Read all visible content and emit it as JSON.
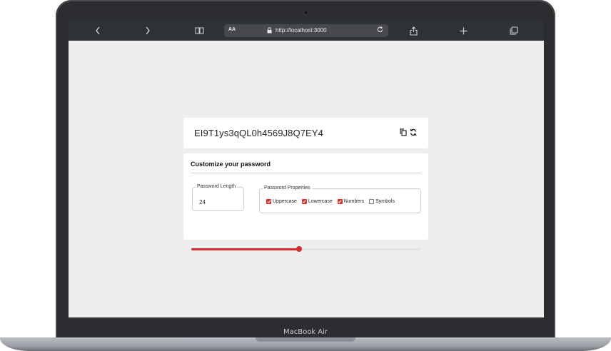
{
  "browser": {
    "address_prefix": "AA",
    "url": "http://localhost:3000",
    "icons": [
      "back-icon",
      "forward-icon",
      "book-icon",
      "lock-icon",
      "reload-icon",
      "share-icon",
      "new-tab-icon",
      "tabs-icon"
    ]
  },
  "password": {
    "value": "EI9T1ys3qQL0h4569J8Q7EY4",
    "icons": [
      "copy-icon",
      "refresh-icon"
    ]
  },
  "customize": {
    "title": "Customize your password",
    "length_label": "Password Length",
    "length_value": "24",
    "properties_label": "Password Properties",
    "options": [
      {
        "label": "Uppercase",
        "checked": true
      },
      {
        "label": "Lowercase",
        "checked": true
      },
      {
        "label": "Numbers",
        "checked": true
      },
      {
        "label": "Symbols",
        "checked": false
      }
    ],
    "slider_fraction": 0.47
  },
  "device": {
    "label": "MacBook Air"
  },
  "colors": {
    "accent": "#d32f2f",
    "page_bg": "#eeeeee",
    "toolbar_bg": "#2e3136"
  }
}
